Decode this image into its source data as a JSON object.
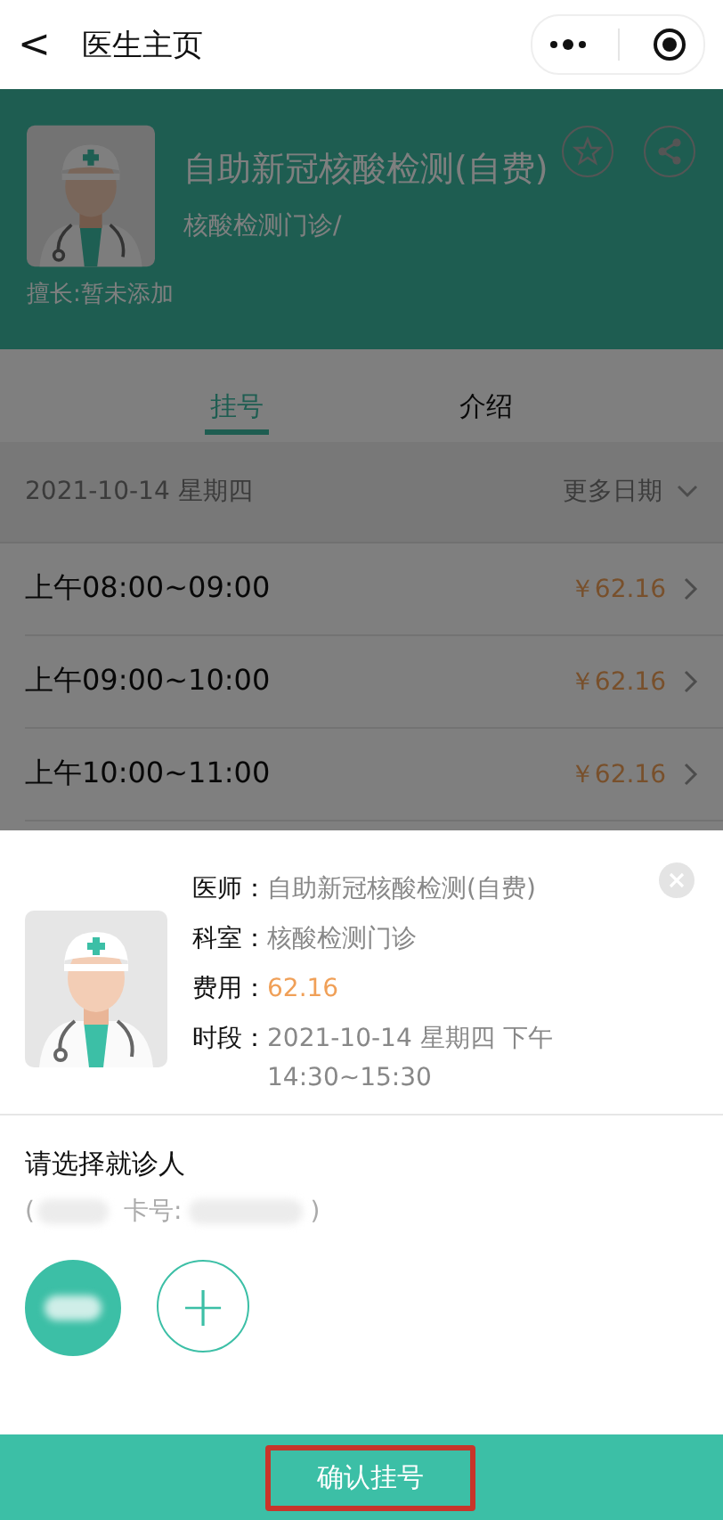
{
  "nav": {
    "back": "<",
    "title": "医生主页"
  },
  "doctor": {
    "name": "自助新冠核酸检测(自费)",
    "department": "核酸检测门诊/",
    "specialty": "擅长:暂未添加",
    "favorited": false
  },
  "tabs": [
    {
      "label": "挂号",
      "selected": true
    },
    {
      "label": "介绍",
      "selected": false
    }
  ],
  "date_bar": {
    "date": "2021-10-14 星期四",
    "more": "更多日期"
  },
  "slots": [
    {
      "time": "上午08:00~09:00",
      "price": "￥62.16"
    },
    {
      "time": "上午09:00~10:00",
      "price": "￥62.16"
    },
    {
      "time": "上午10:00~11:00",
      "price": "￥62.16"
    }
  ],
  "sheet": {
    "details": [
      {
        "label": "医师：",
        "value": "自助新冠核酸检测(自费)",
        "kind": "plain"
      },
      {
        "label": "科室：",
        "value": "核酸检测门诊",
        "kind": "plain"
      },
      {
        "label": "费用：",
        "value": "62.16",
        "kind": "price"
      },
      {
        "label": "时段：",
        "value": "2021-10-14 星期四 下午 14:30~15:30",
        "kind": "plain"
      }
    ],
    "patient_prompt": "请选择就诊人",
    "patient_info": {
      "open": "(",
      "card_label": "卡号:",
      "close": ")"
    },
    "patients": [
      {
        "selected": true
      }
    ],
    "add_patient": "+",
    "confirm": "确认挂号"
  }
}
